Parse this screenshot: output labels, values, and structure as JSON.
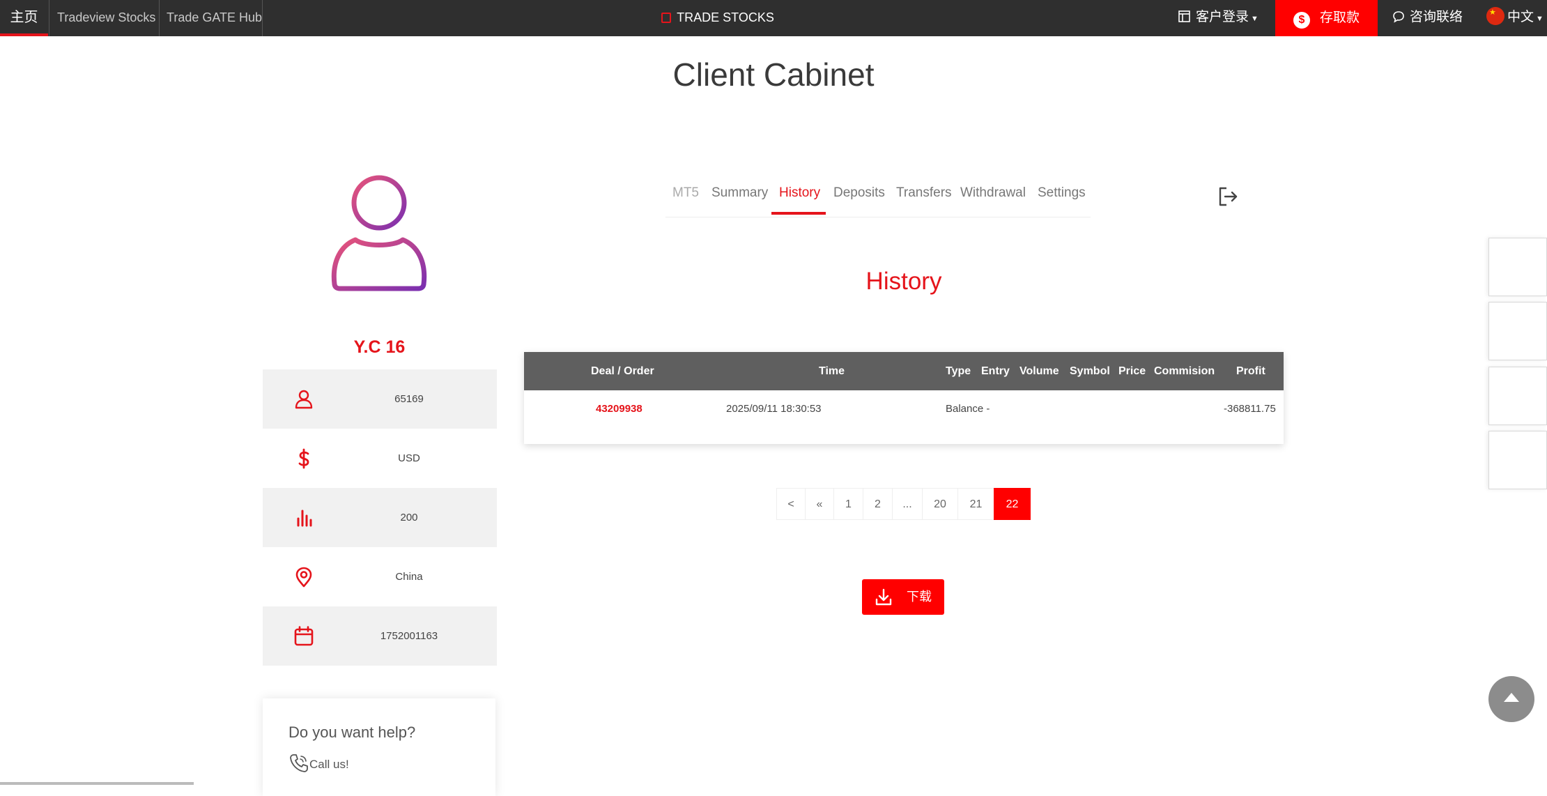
{
  "topbar": {
    "home": "主页",
    "link1": "Tradeview Stocks",
    "link2": "Trade GATE Hub",
    "center_title": "TRADE STOCKS",
    "client_login": "客户登录",
    "deposit": "存取款",
    "contact": "咨询联络",
    "language": "中文"
  },
  "page_title": "Client Cabinet",
  "profile": {
    "name": "Y.C 16",
    "rows": [
      {
        "icon": "user-icon",
        "value": "65169"
      },
      {
        "icon": "dollar-icon",
        "value": "USD"
      },
      {
        "icon": "bar-chart-icon",
        "value": "200"
      },
      {
        "icon": "location-pin-icon",
        "value": "China"
      },
      {
        "icon": "calendar-icon",
        "value": "1752001163"
      }
    ]
  },
  "help": {
    "title": "Do you want help?",
    "call": "Call us!"
  },
  "tabs": [
    "MT5",
    "Summary",
    "History",
    "Deposits",
    "Transfers",
    "Withdrawal",
    "Settings"
  ],
  "active_tab": "History",
  "section_title": "History",
  "table": {
    "headers": [
      "Deal / Order",
      "Time",
      "Type",
      "Entry",
      "Volume",
      "Symbol",
      "Price",
      "Commision",
      "Profit"
    ],
    "rows": [
      {
        "deal": "43209938",
        "time": "2025/09/11 18:30:53",
        "type": "Balance -",
        "profit": "-368811.75"
      }
    ]
  },
  "pagination": [
    "<",
    "«",
    "1",
    "2",
    "...",
    "20",
    "21",
    "22"
  ],
  "current_page": "22",
  "download_label": "下载",
  "colors": {
    "accent": "#e5141b",
    "topbar": "#2f2f2f",
    "table_header": "#5f5f5f"
  }
}
